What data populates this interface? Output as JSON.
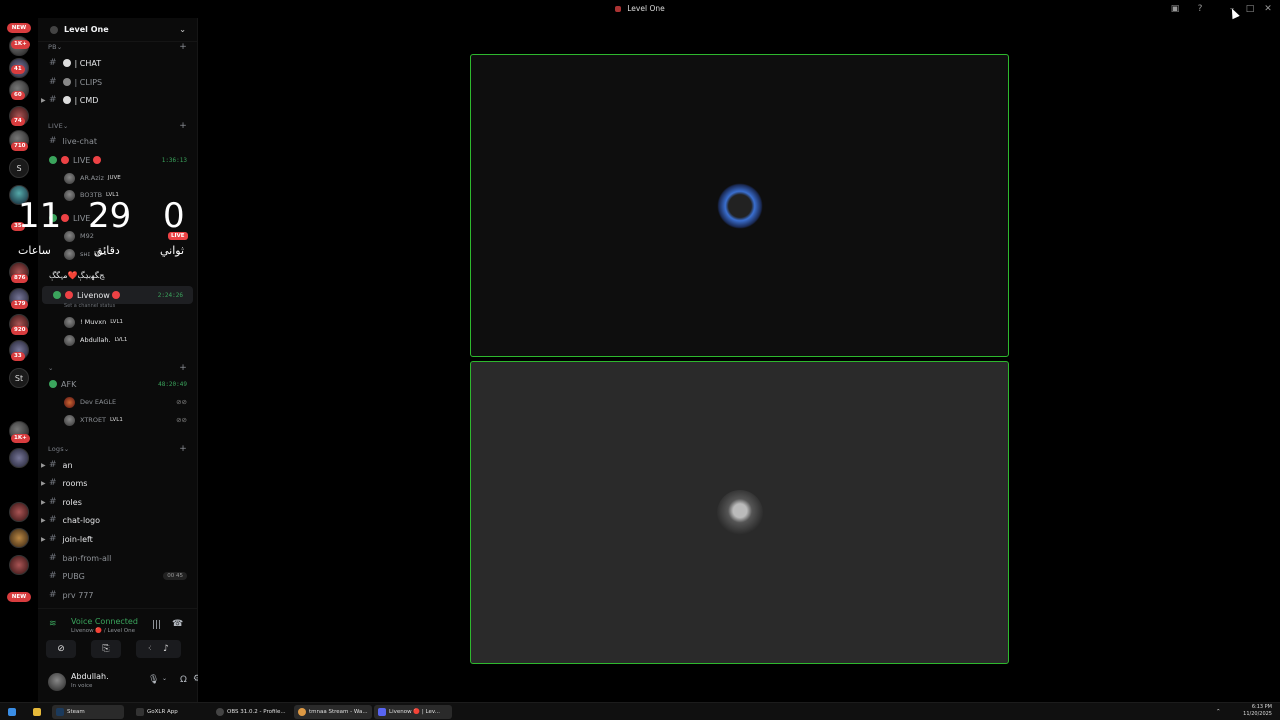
{
  "window": {
    "title": "Level One"
  },
  "guild": {
    "name": "Level One"
  },
  "rail": {
    "new_top": "NEW",
    "badges": [
      "1K+",
      "41",
      "60",
      "74",
      "710",
      "35",
      "876",
      "179",
      "920",
      "33",
      "1K+"
    ],
    "text_servers": [
      "S",
      "St"
    ],
    "new_bottom": "NEW"
  },
  "channels": {
    "cat_pb": "PB",
    "chat": "| CHAT",
    "clips": "| CLIPS",
    "cmd": "| CMD",
    "cat_live": "LIVE",
    "live_chat": "live-chat",
    "live1": "LIVE",
    "live1_timer": "1:36:13",
    "live1_user1": "ΑR.Aziz",
    "live1_user1_tag": "JUVE",
    "live1_user2": "BO3TB",
    "live1_user2_tag": "LVL1",
    "live2": "LIVE",
    "live2_user1": "M92",
    "live2_user2": "sʜɪ",
    "live2_user2_tag": "LVL1",
    "weird_channel": "ﺞﮕﻬﺑﮃ‌ﮗ❤️ﻣﮩﮕﮗ",
    "livenow": "Livenow",
    "livenow_timer": "2:24:26",
    "livenow_status": "Set a channel status",
    "livenow_user1": "! Muvxn",
    "livenow_user1_tag": "LVL1",
    "livenow_user2": "Abdullah.",
    "livenow_user2_tag": "LVL1",
    "afk": "AFK",
    "afk_timer": "48:20:49",
    "afk_user1": "Dev EAGLE",
    "afk_user2": "XTROET",
    "afk_user2_tag": "LVL1",
    "cat_logs": "Logs",
    "an": "an",
    "rooms": "rooms",
    "roles": "roles",
    "chat_logo": "chat-logo",
    "join_left": "join-left",
    "ban_from_all": "ban-from-all",
    "pubg": "PUBG",
    "pubg_count": "00 45",
    "prv": "prv 777"
  },
  "clock": {
    "hours": "11",
    "minutes": "29",
    "seconds": "0",
    "hours_label": "ساعات",
    "minutes_label": "دقائق",
    "seconds_label": "ثواني",
    "live_badge": "LIVE"
  },
  "voice": {
    "status": "Voice Connected",
    "location": "Livenow 🔴 / Level One"
  },
  "user": {
    "name": "Abdullah.",
    "status": "In voice"
  },
  "taskbar": {
    "items": [
      "Steam",
      "GoXLR App",
      "OBS 31.0.2 - Profile...",
      "tmnaa Stream - Wa...",
      "Livenow 🔴 | Lev..."
    ],
    "time": "6:13 PM",
    "date": "11/20/2025"
  },
  "colors": {
    "accent_green": "#3ba55d",
    "tile_border": "#2eb82e",
    "badge_red": "#d83c3e"
  }
}
